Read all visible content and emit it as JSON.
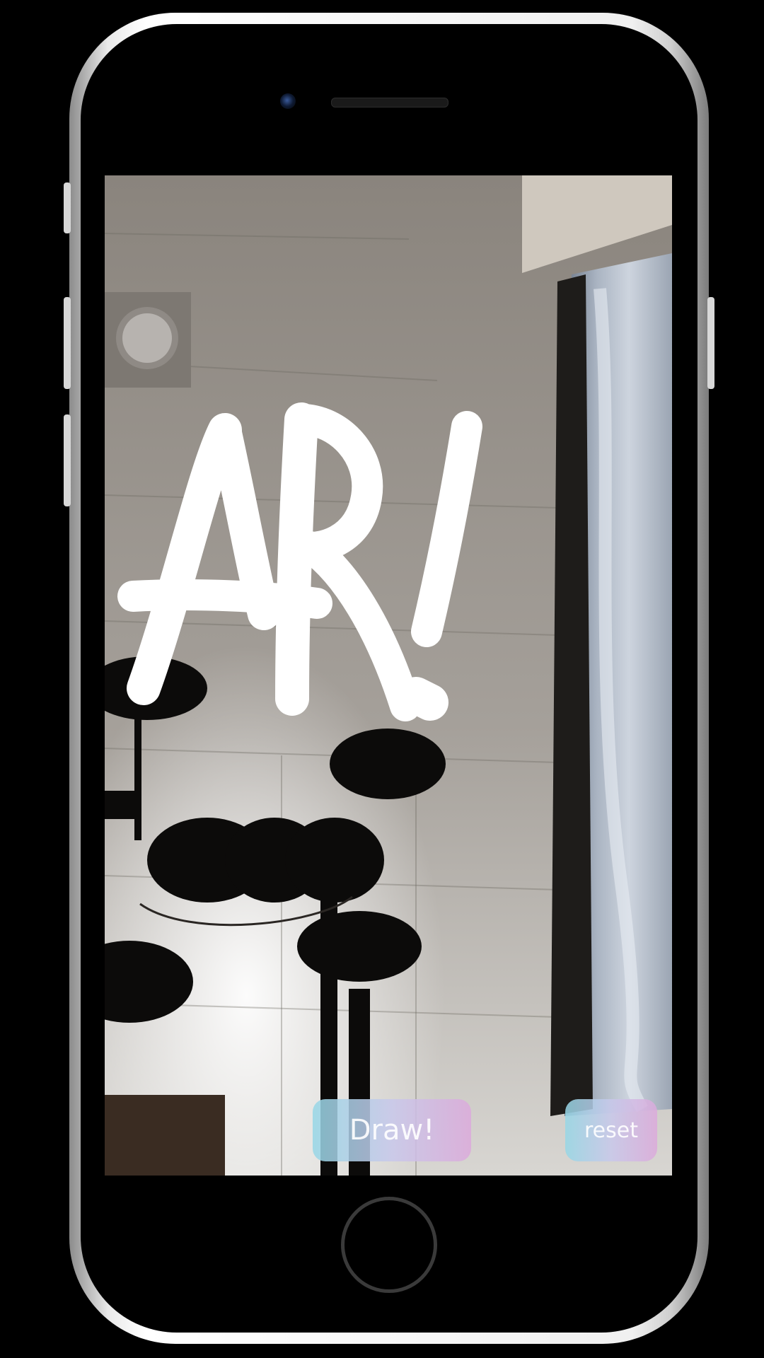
{
  "app": {
    "drawing_text": "AR!"
  },
  "controls": {
    "draw_label": "Draw!",
    "reset_label": "reset"
  },
  "icons": {
    "front_camera": "camera-icon",
    "speaker": "speaker-icon",
    "home": "home-button"
  },
  "colors": {
    "device_frame": "#f2f2f2",
    "screen_bezel": "#000000",
    "drawing_stroke": "#ffffff",
    "button_gradient_start": "#96d7e6",
    "button_gradient_end": "#dcaadc"
  }
}
